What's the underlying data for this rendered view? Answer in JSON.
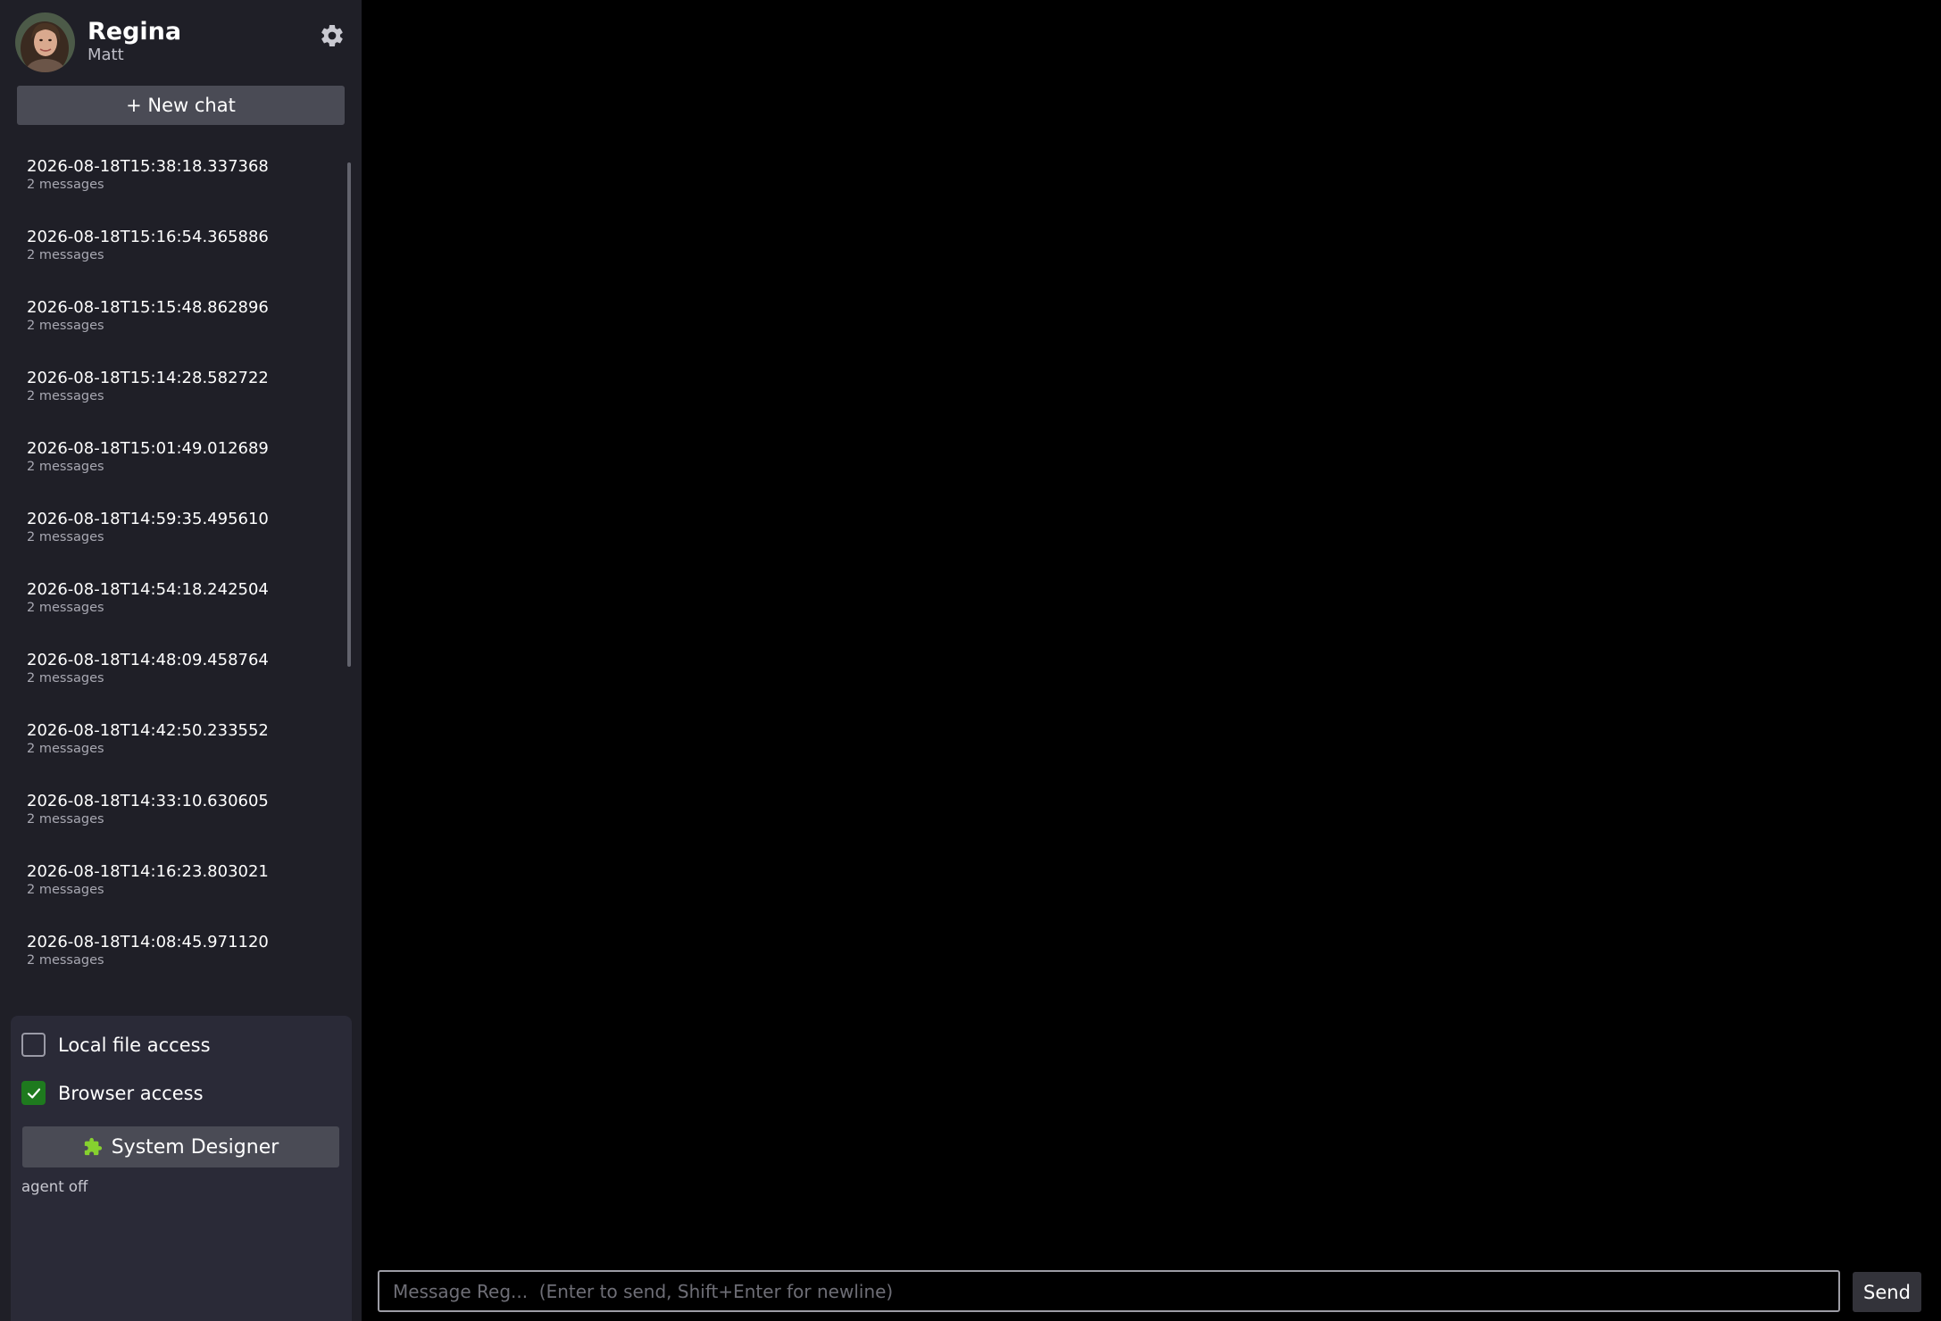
{
  "profile": {
    "title": "Regina",
    "subtitle": "Matt"
  },
  "sidebar": {
    "new_chat_label": "+ New chat",
    "chats": [
      {
        "title": "2026-08-18T15:38:18.337368",
        "count": "2 messages"
      },
      {
        "title": "2026-08-18T15:16:54.365886",
        "count": "2 messages"
      },
      {
        "title": "2026-08-18T15:15:48.862896",
        "count": "2 messages"
      },
      {
        "title": "2026-08-18T15:14:28.582722",
        "count": "2 messages"
      },
      {
        "title": "2026-08-18T15:01:49.012689",
        "count": "2 messages"
      },
      {
        "title": "2026-08-18T14:59:35.495610",
        "count": "2 messages"
      },
      {
        "title": "2026-08-18T14:54:18.242504",
        "count": "2 messages"
      },
      {
        "title": "2026-08-18T14:48:09.458764",
        "count": "2 messages"
      },
      {
        "title": "2026-08-18T14:42:50.233552",
        "count": "2 messages"
      },
      {
        "title": "2026-08-18T14:33:10.630605",
        "count": "2 messages"
      },
      {
        "title": "2026-08-18T14:16:23.803021",
        "count": "2 messages"
      },
      {
        "title": "2026-08-18T14:08:45.971120",
        "count": "2 messages"
      }
    ]
  },
  "options": {
    "local_file_access": {
      "label": "Local file access",
      "checked": false
    },
    "browser_access": {
      "label": "Browser access",
      "checked": true
    },
    "designer_label": "System Designer",
    "agent_status": "agent off"
  },
  "composer": {
    "placeholder": "Message Reg...  (Enter to send, Shift+Enter for newline)",
    "value": "",
    "send_label": "Send"
  },
  "colors": {
    "sidebar_bg": "#1f1f27",
    "panel_bg": "#2a2a37",
    "button_bg": "#4a4b55",
    "check_green": "#1e7a1e",
    "main_bg": "#000000"
  },
  "icons": {
    "settings": "gear-icon",
    "designer": "puzzle-icon",
    "check": "check-icon"
  }
}
